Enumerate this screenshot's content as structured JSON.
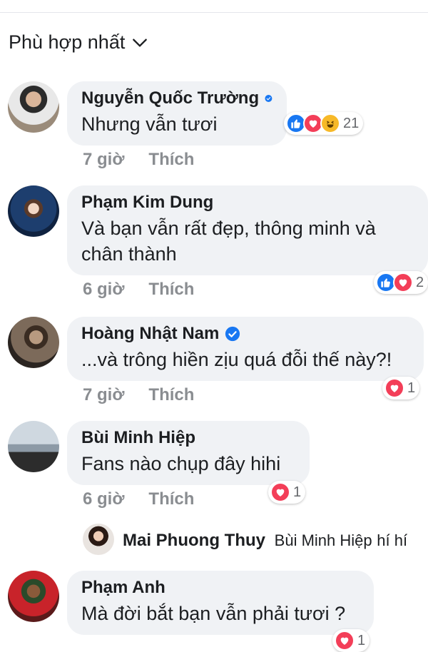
{
  "sort": {
    "label": "Phù hợp nhất",
    "icon": "chevron-down-icon"
  },
  "like_label": "Thích",
  "comments": [
    {
      "name": "Nguyễn Quốc Trường",
      "verified": true,
      "text": "Nhưng vẫn tươi",
      "time": "7 giờ",
      "reactions": [
        "like",
        "love",
        "haha"
      ],
      "reaction_count": "21"
    },
    {
      "name": "Phạm Kim Dung",
      "verified": false,
      "text_lines": [
        "Và bạn vẫn rất đẹp, thông minh và",
        "chân thành"
      ],
      "time": "6 giờ",
      "reactions": [
        "like",
        "love"
      ],
      "reaction_count": "2"
    },
    {
      "name": "Hoàng Nhật Nam",
      "verified": true,
      "text": "...và trông hiền zịu quá đỗi thế này?!",
      "time": "7 giờ",
      "reactions": [
        "love"
      ],
      "reaction_count": "1"
    },
    {
      "name": "Bùi Minh Hiệp",
      "verified": false,
      "text": "Fans nào chụp đây hihi",
      "time": "6 giờ",
      "reactions": [
        "love"
      ],
      "reaction_count": "1"
    },
    {
      "name": "Phạm Anh",
      "verified": false,
      "text": "Mà đời bắt bạn vẫn phải tươi ?",
      "time": "",
      "reactions": [
        "love"
      ],
      "reaction_count": "1"
    }
  ],
  "reply": {
    "name": "Mai Phuong Thuy",
    "mention": "Bùi Minh Hiệp",
    "text": "hí hí"
  },
  "colors": {
    "bubble": "#f0f2f5",
    "meta": "#8a8d91",
    "verified": "#1877f2",
    "like": "#1877f2",
    "love": "#f33e58",
    "haha": "#f7b928"
  }
}
